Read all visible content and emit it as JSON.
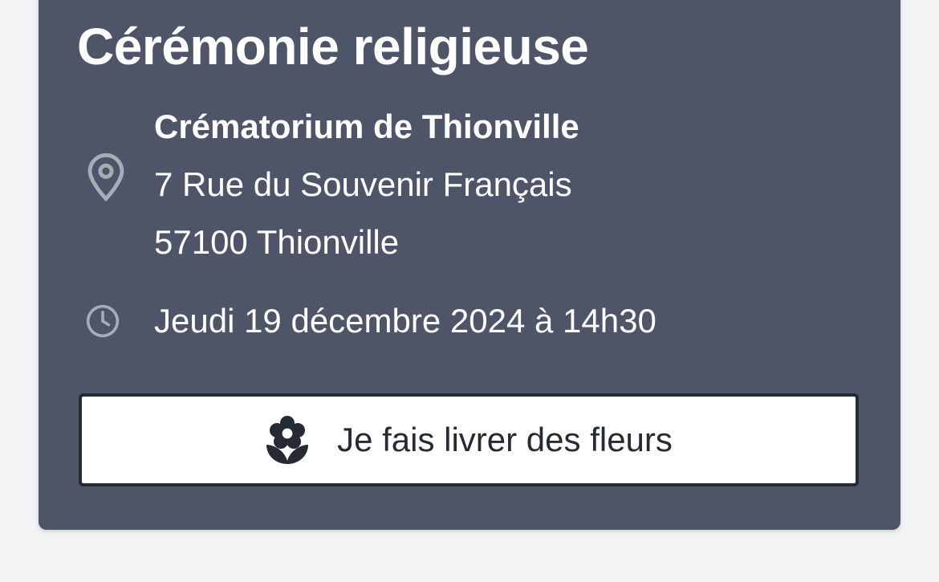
{
  "ceremony": {
    "title": "Cérémonie religieuse",
    "venue": "Crématorium de Thionville",
    "address_line1": "7 Rue du Souvenir Français",
    "address_line2": "57100 Thionville",
    "datetime": "Jeudi 19 décembre 2024 à 14h30",
    "icons": {
      "location": "map-pin-icon",
      "time": "clock-icon",
      "button": "flower-icon"
    }
  },
  "actions": {
    "flowers_button_label": "Je fais livrer des fleurs"
  },
  "colors": {
    "card_background": "#4f5568",
    "page_background": "#f2f3f5",
    "text_on_card": "#ffffff",
    "icon_muted": "#a8acb5",
    "button_text": "#262a33"
  }
}
